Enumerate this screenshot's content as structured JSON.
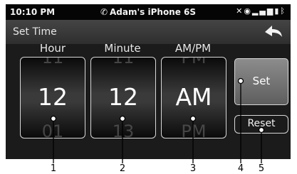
{
  "statusbar": {
    "time": "10:10 PM",
    "device": "Adam's iPhone 6S",
    "phone_icon": "phone-icon",
    "status_icons": "mute-icon, alert-icon, signal-icon, battery-icon, bluetooth-icon"
  },
  "titlebar": {
    "title": "Set Time",
    "back_icon": "back-arrow-icon"
  },
  "columns": [
    {
      "label": "Hour",
      "prev": "11",
      "value": "12",
      "next": "01"
    },
    {
      "label": "Minute",
      "prev": "11",
      "value": "12",
      "next": "13"
    },
    {
      "label": "AM/PM",
      "prev": "PM",
      "value": "AM",
      "next": "PM"
    }
  ],
  "buttons": {
    "set": "Set",
    "reset": "Reset"
  },
  "callouts": [
    "1",
    "2",
    "3",
    "4",
    "5"
  ],
  "colors": {
    "screen_bg": "#1b1b1b",
    "callout_line": "#000000"
  }
}
